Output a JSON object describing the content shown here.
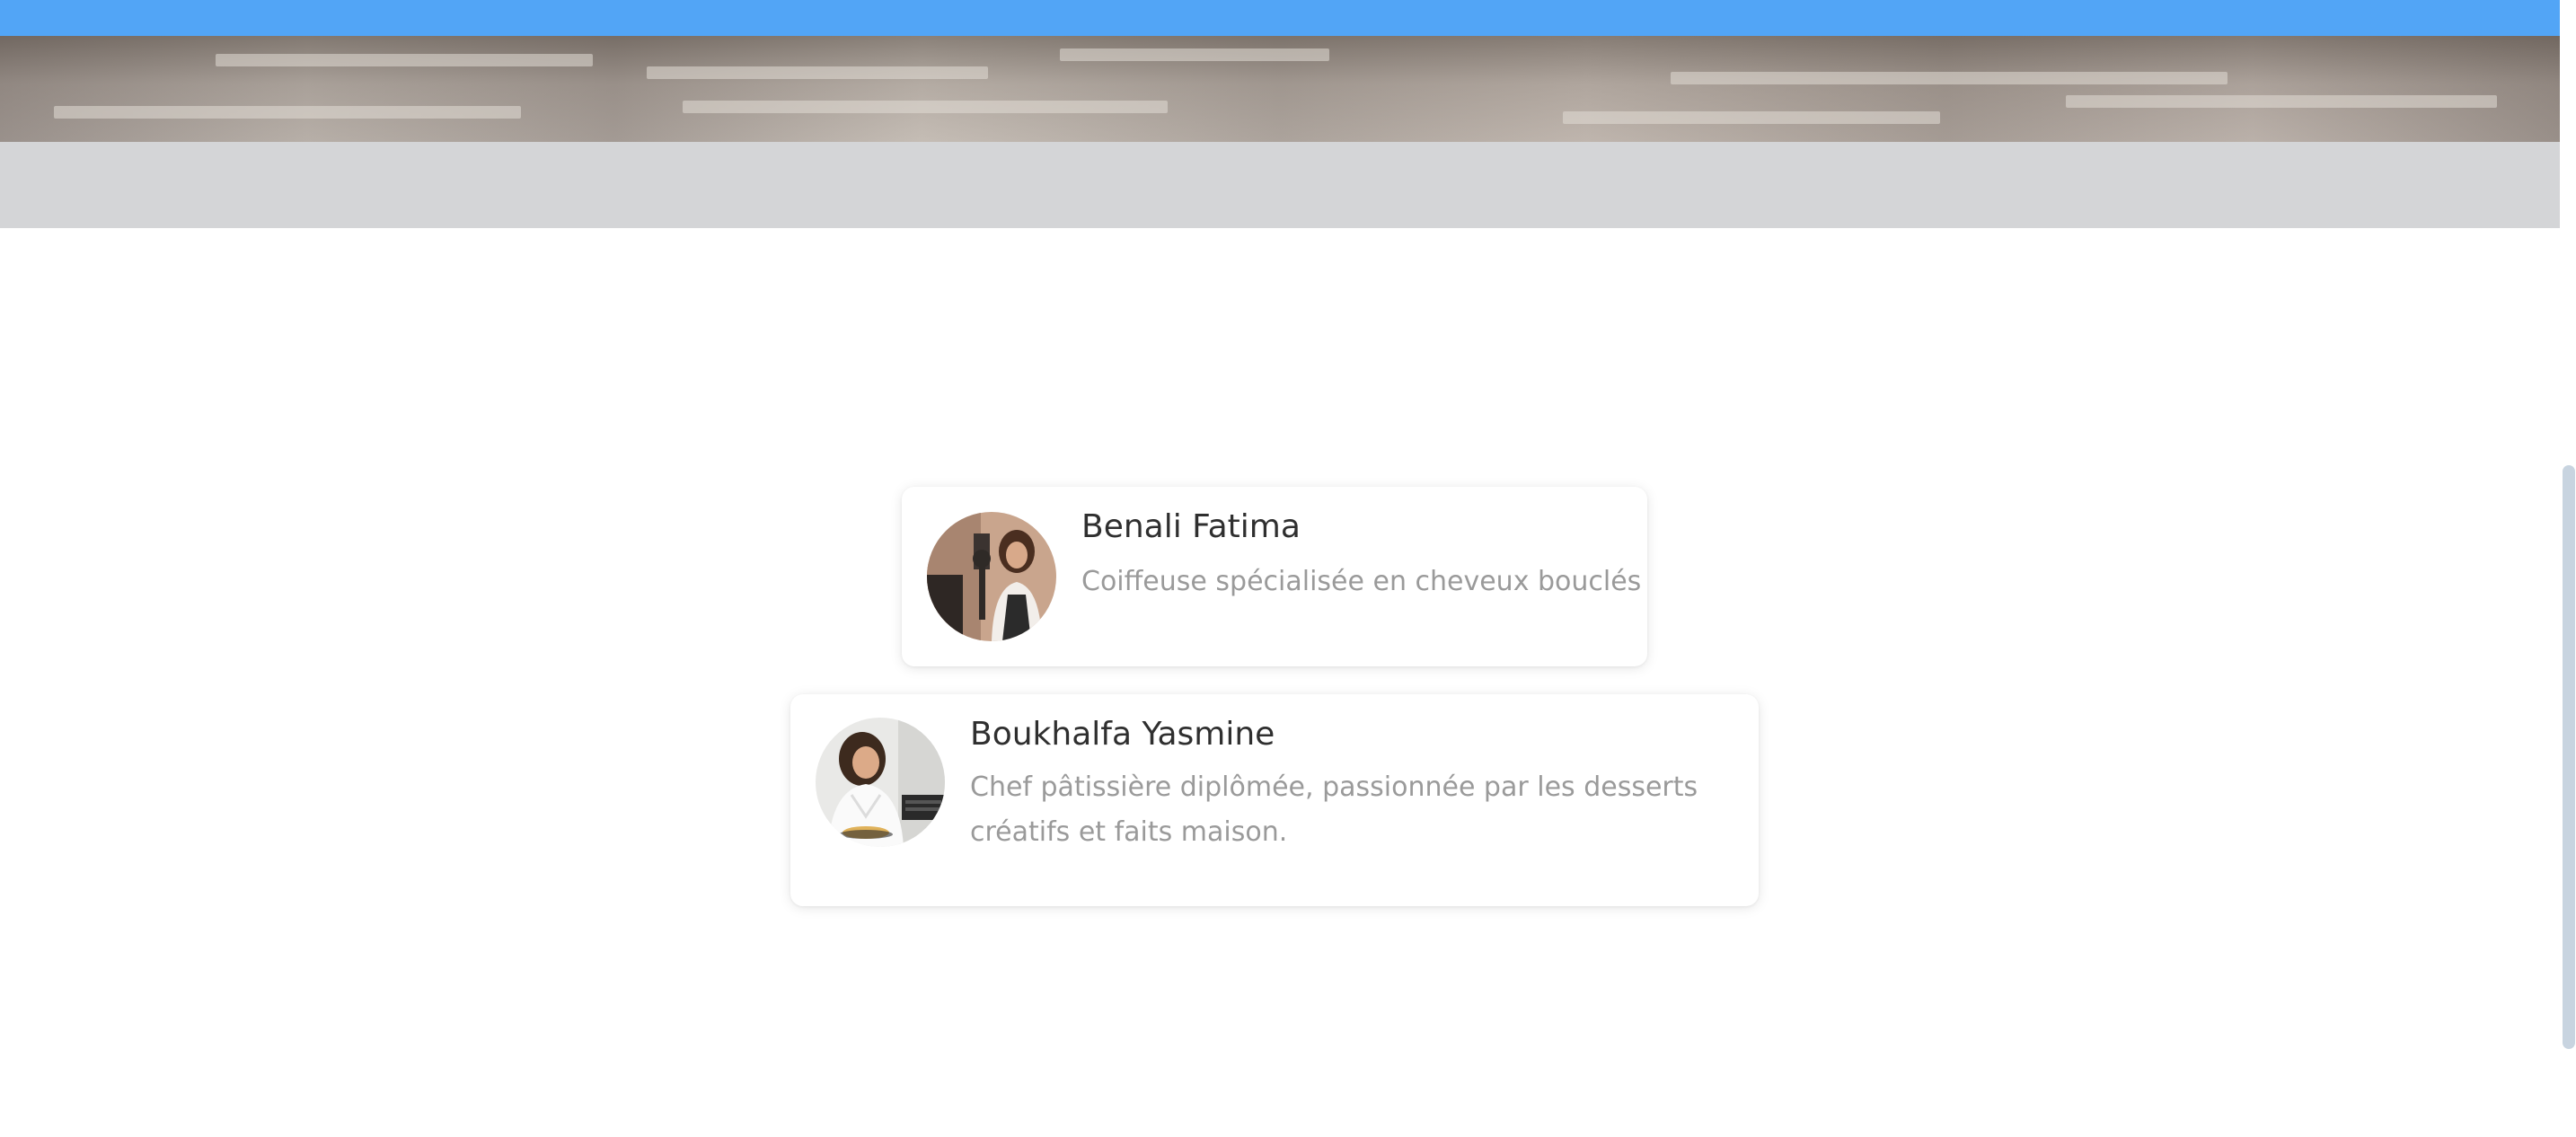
{
  "profiles": [
    {
      "name": "Benali Fatima",
      "description": "Coiffeuse spécialisée en cheveux bouclés",
      "avatar_icon": "woman-hairdresser-photo"
    },
    {
      "name": "Boukhalfa Yasmine",
      "description": "Chef pâtissière diplômée, passionnée par les desserts créatifs et faits maison.",
      "avatar_icon": "woman-pastry-chef-photo"
    }
  ],
  "colors": {
    "top_bar": "#52a5f6",
    "grey_band": "#d4d5d7",
    "name_text": "#2f2f2f",
    "desc_text": "#9a9a9a"
  }
}
